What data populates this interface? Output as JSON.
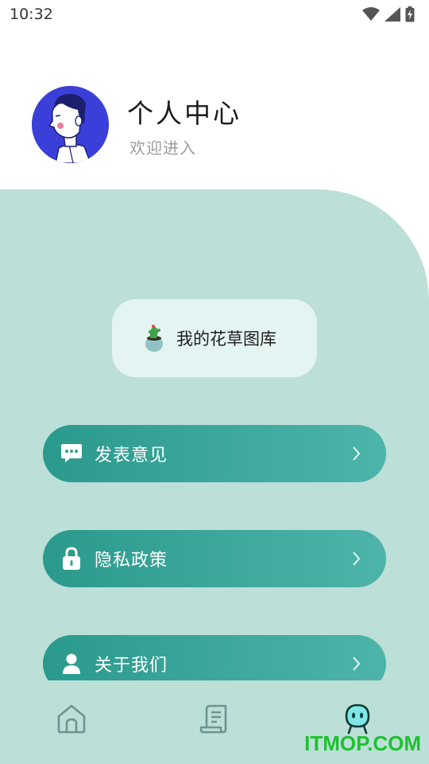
{
  "status_bar": {
    "time": "10:32"
  },
  "profile": {
    "title": "个人中心",
    "subtitle": "欢迎进入"
  },
  "gallery": {
    "label": "我的花草图库"
  },
  "menu": [
    {
      "label": "发表意见",
      "icon": "message-icon"
    },
    {
      "label": "隐私政策",
      "icon": "lock-icon"
    },
    {
      "label": "关于我们",
      "icon": "person-icon"
    }
  ],
  "tabbar": {
    "tabs": [
      {
        "icon": "home-icon",
        "active": false
      },
      {
        "icon": "scroll-icon",
        "active": false
      },
      {
        "icon": "robot-face-icon",
        "active": true
      }
    ]
  },
  "watermark": "ITMOP.COM",
  "colors": {
    "panel": "#bcdfd8",
    "button_start": "#2a9a8c",
    "button_end": "#4db4a9",
    "card": "#e4f4f3",
    "avatar_bg": "#3a3fd9",
    "watermark": "#1dc22d"
  }
}
